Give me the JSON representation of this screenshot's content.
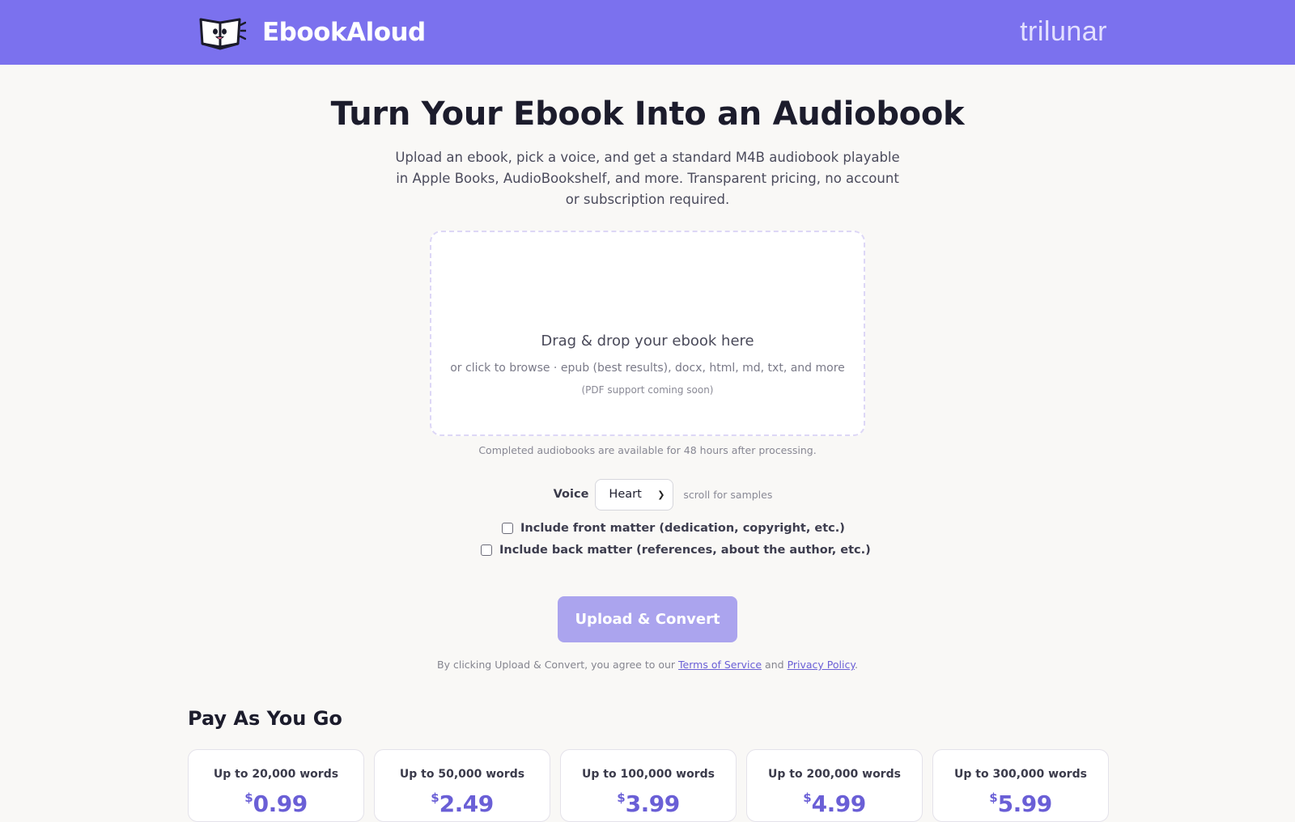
{
  "header": {
    "brand_name": "EbookAloud",
    "partner_logo_text": "trilunar",
    "logo_icon": "book-mascot-icon",
    "background": "#7b71ee"
  },
  "hero": {
    "title": "Turn Your Ebook Into an Audiobook",
    "subtitle": "Upload an ebook, pick a voice, and get a standard M4B audiobook playable in Apple Books, AudioBookshelf, and more. Transparent pricing, no account or subscription required."
  },
  "dropzone": {
    "title": "Drag & drop your ebook here",
    "subtitle": "or click to browse · epub (best results), docx, html, md, txt, and more",
    "note": "(PDF support coming soon)"
  },
  "retention_note": "Completed audiobooks are available for 48 hours after processing.",
  "voice": {
    "label": "Voice",
    "selected": "Heart",
    "hint": "scroll for samples"
  },
  "options": {
    "front_matter": "Include front matter (dedication, copyright, etc.)",
    "back_matter": "Include back matter (references, about the author, etc.)"
  },
  "cta": {
    "label": "Upload & Convert",
    "color": "#aba4ee"
  },
  "legal": {
    "prefix": "By clicking Upload & Convert, you agree to our",
    "terms": "Terms of Service",
    "and": "and",
    "privacy": "Privacy Policy",
    "suffix": "."
  },
  "pricing": {
    "title": "Pay As You Go",
    "currency": "$",
    "plans": [
      {
        "words": "Up to 20,000 words",
        "price": "0.99"
      },
      {
        "words": "Up to 50,000 words",
        "price": "2.49"
      },
      {
        "words": "Up to 100,000 words",
        "price": "3.99"
      },
      {
        "words": "Up to 200,000 words",
        "price": "4.99"
      },
      {
        "words": "Up to 300,000 words",
        "price": "5.99"
      }
    ],
    "accent": "#6a5fd6"
  }
}
